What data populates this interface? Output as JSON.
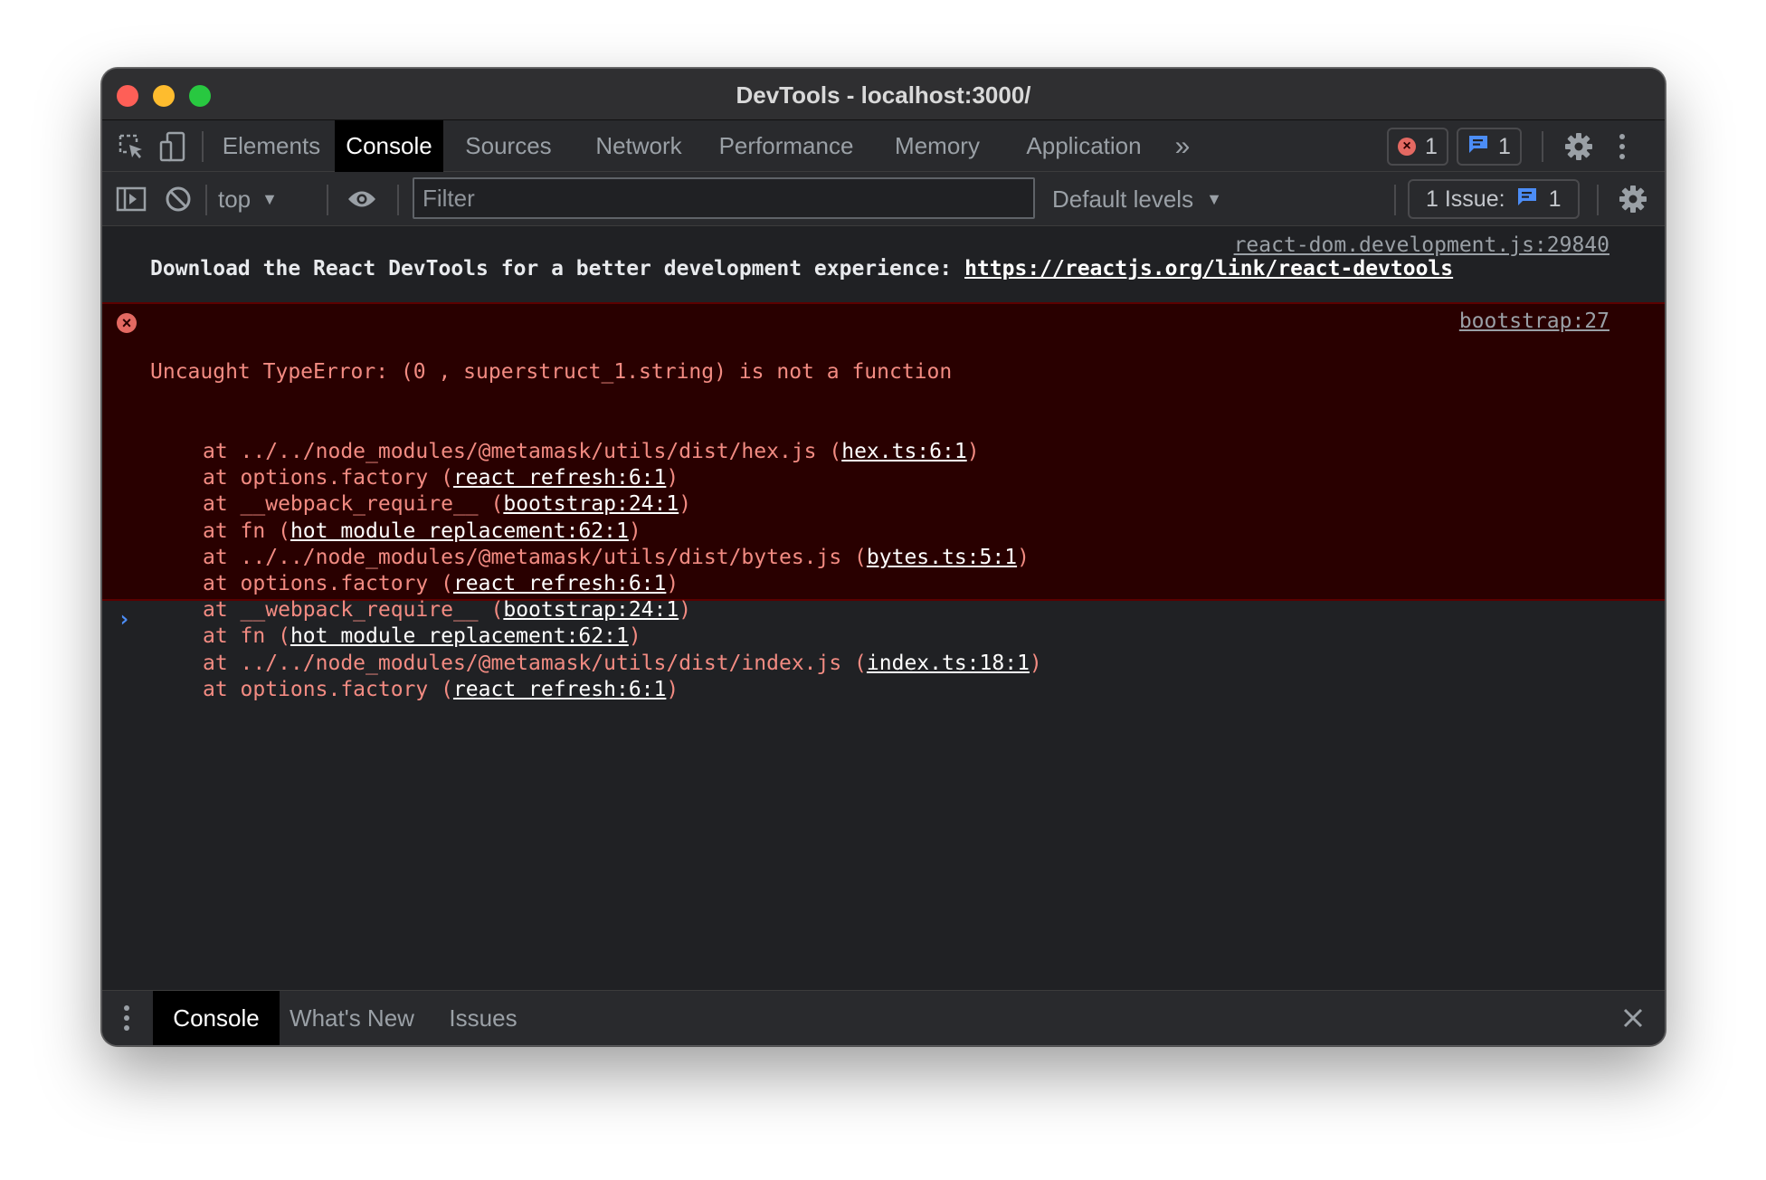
{
  "window": {
    "title": "DevTools - localhost:3000/"
  },
  "tabs": [
    {
      "label": "Elements"
    },
    {
      "label": "Console",
      "active": true
    },
    {
      "label": "Sources"
    },
    {
      "label": "Network"
    },
    {
      "label": "Performance"
    },
    {
      "label": "Memory"
    },
    {
      "label": "Application"
    }
  ],
  "tabbar": {
    "more_label": "»",
    "error_count": "1",
    "message_count": "1"
  },
  "console_toolbar": {
    "context": "top",
    "filter_placeholder": "Filter",
    "levels": "Default levels",
    "issue_label": "1 Issue:",
    "issue_count": "1"
  },
  "messages": {
    "info": {
      "source": "react-dom.development.js:29840",
      "text": "Download the React DevTools for a better development experience: ",
      "link": "https://reactjs.org/link/react-devtools"
    },
    "error": {
      "source": "bootstrap:27",
      "title": "Uncaught TypeError: (0 , superstruct_1.string) is not a function",
      "stack": [
        {
          "prefix": "at ../../node_modules/@metamask/utils/dist/hex.js (",
          "link": "hex.ts:6:1",
          "suffix": ")"
        },
        {
          "prefix": "at options.factory (",
          "link": "react refresh:6:1",
          "suffix": ")"
        },
        {
          "prefix": "at __webpack_require__ (",
          "link": "bootstrap:24:1",
          "suffix": ")"
        },
        {
          "prefix": "at fn (",
          "link": "hot module replacement:62:1",
          "suffix": ")"
        },
        {
          "prefix": "at ../../node_modules/@metamask/utils/dist/bytes.js (",
          "link": "bytes.ts:5:1",
          "suffix": ")"
        },
        {
          "prefix": "at options.factory (",
          "link": "react refresh:6:1",
          "suffix": ")"
        },
        {
          "prefix": "at __webpack_require__ (",
          "link": "bootstrap:24:1",
          "suffix": ")"
        },
        {
          "prefix": "at fn (",
          "link": "hot module replacement:62:1",
          "suffix": ")"
        },
        {
          "prefix": "at ../../node_modules/@metamask/utils/dist/index.js (",
          "link": "index.ts:18:1",
          "suffix": ")"
        },
        {
          "prefix": "at options.factory (",
          "link": "react refresh:6:1",
          "suffix": ")"
        }
      ]
    }
  },
  "prompt": "›",
  "drawer": {
    "tabs": [
      {
        "label": "Console",
        "active": true
      },
      {
        "label": "What's New"
      },
      {
        "label": "Issues"
      }
    ]
  },
  "colors": {
    "error_text": "#f28b82",
    "error_bg": "#290000",
    "link_blue": "#4c8df6",
    "panel_bg": "#202124"
  },
  "icons": [
    "inspect-element-icon",
    "device-toolbar-icon",
    "more-tabs-icon",
    "error-icon",
    "message-icon",
    "gear-icon",
    "kebab-menu-icon",
    "sidebar-toggle-icon",
    "clear-console-icon",
    "dropdown-arrow-icon",
    "eye-icon",
    "close-icon"
  ]
}
